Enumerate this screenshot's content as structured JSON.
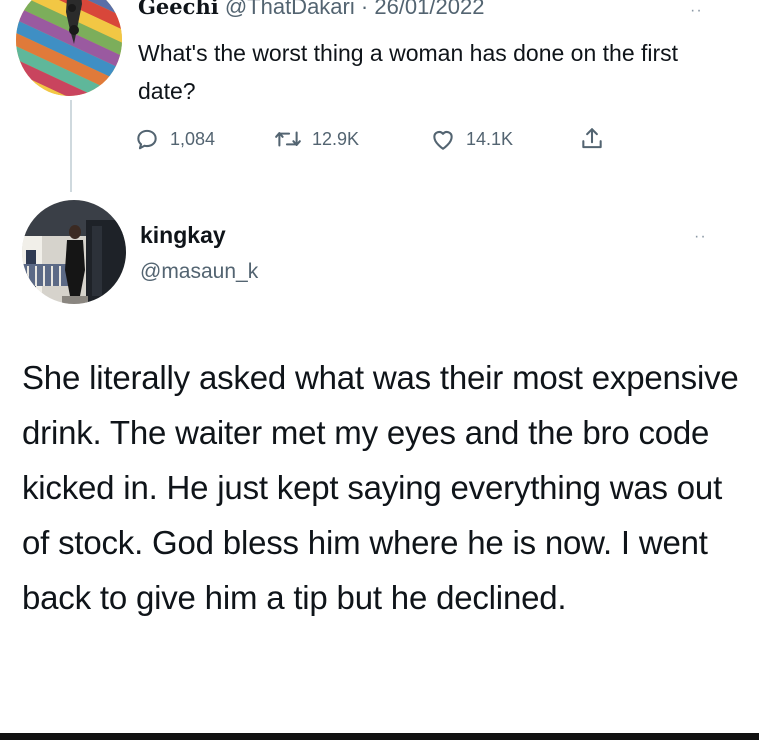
{
  "parent_tweet": {
    "display_name": "Geechi",
    "handle": "@ThatDakari",
    "separator": "·",
    "date": "26/01/2022",
    "more": "··",
    "text": "What's the worst thing a woman has done on the first date?",
    "actions": {
      "replies": "1,084",
      "retweets": "12.9K",
      "likes": "14.1K"
    }
  },
  "reply_tweet": {
    "display_name": "kingkay",
    "handle": "@masaun_k",
    "more": "··",
    "text": "She literally asked what was their most expensive drink. The waiter met my eyes and the bro code kicked in. He just kept saying everything was out of stock. God bless him where he is now. I went back to give him a tip but he declined."
  },
  "icons": {
    "reply": "reply-icon",
    "retweet": "retweet-icon",
    "like": "heart-icon",
    "share": "share-icon"
  },
  "colors": {
    "text_primary": "#0f1419",
    "text_secondary": "#536471",
    "thread_line": "#cfd9de"
  }
}
